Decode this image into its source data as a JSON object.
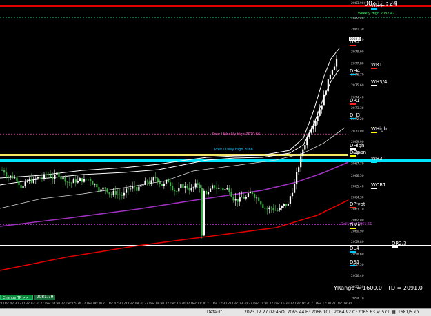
{
  "timer": "00:11:24",
  "price_axis": [
    "2083.90",
    "2082.40",
    "2081.30",
    "2080.20",
    "2079.00",
    "2077.80",
    "2076.70",
    "2075.60",
    "2074.40",
    "2073.30",
    "2072.20",
    "2071.00",
    "2069.90",
    "2068.80",
    "2067.70",
    "2066.50",
    "2065.40",
    "2064.30",
    "2063.10",
    "2062.00",
    "2060.90",
    "2059.80",
    "2058.60",
    "2057.50",
    "2056.40",
    "2055.30",
    "2054.10"
  ],
  "current_price": "2080.24",
  "time_axis": [
    "27 Dec 02:30",
    "27 Dec 03:30",
    "27 Dec 04:30",
    "27 Dec 05:30",
    "27 Dec 06:30",
    "27 Dec 07:30",
    "27 Dec 08:30",
    "27 Dec 09:30",
    "27 Dec 10:30",
    "27 Dec 11:30",
    "27 Dec 12:30",
    "27 Dec 13:30",
    "27 Dec 14:30",
    "27 Dec 15:30",
    "27 Dec 16:30",
    "27 Dec 17:30",
    "27 Dec 18:30"
  ],
  "levels": [
    {
      "label": "WH4",
      "color": "#00c8ff"
    },
    {
      "label": "DR2",
      "color": "#ff2020"
    },
    {
      "label": "WR1",
      "color": "#ff2020"
    },
    {
      "label": "DH4",
      "color": "#00c8ff"
    },
    {
      "label": "WH3/4",
      "color": "#ffffff"
    },
    {
      "label": "DR1",
      "color": "#ff2020"
    },
    {
      "label": "DH3",
      "color": "#00c8ff"
    },
    {
      "label": "WHigh",
      "color": "#ffff00"
    },
    {
      "label": "DHigh",
      "color": "#ffffff"
    },
    {
      "label": "DOpen",
      "color": "#ffff00"
    },
    {
      "label": "WH3",
      "color": "#00e5ff"
    },
    {
      "label": "WOR1",
      "color": "#ffffff"
    },
    {
      "label": "DPivot",
      "color": "#ff2020"
    },
    {
      "label": "DMid",
      "color": "#ffff00"
    },
    {
      "label": "QR2/3",
      "color": "#ffffff"
    },
    {
      "label": "DL4",
      "color": "#00c8ff"
    },
    {
      "label": "DS1",
      "color": "#00c8ff"
    }
  ],
  "annotations": {
    "weekly_high": "Weekly High 2082.42",
    "prev_weekly_high": "Prev / Weekly High 2070.66",
    "prev_daily_high": "Prev / Daily High 2068",
    "daily_mid": "Daily Mid 2061.51"
  },
  "change_tp": {
    "label": "Change TP >>",
    "value": "2081.79"
  },
  "yrange": {
    "text": "YRange = 1600.0",
    "td": "TD = 2091.0"
  },
  "status_bar": {
    "profile": "Default",
    "datetime": "2023.12.27 02:45",
    "open": "O: 2065.44",
    "high": "H: 2066.10",
    "low": "L: 2064.92",
    "close": "C: 2065.63",
    "volume": "V: 571",
    "traffic": "1681/5 kb"
  },
  "colors": {
    "background": "#000000",
    "bull": "#ffffff",
    "bear": "#3cb043",
    "grid": "#1a1a1a"
  }
}
